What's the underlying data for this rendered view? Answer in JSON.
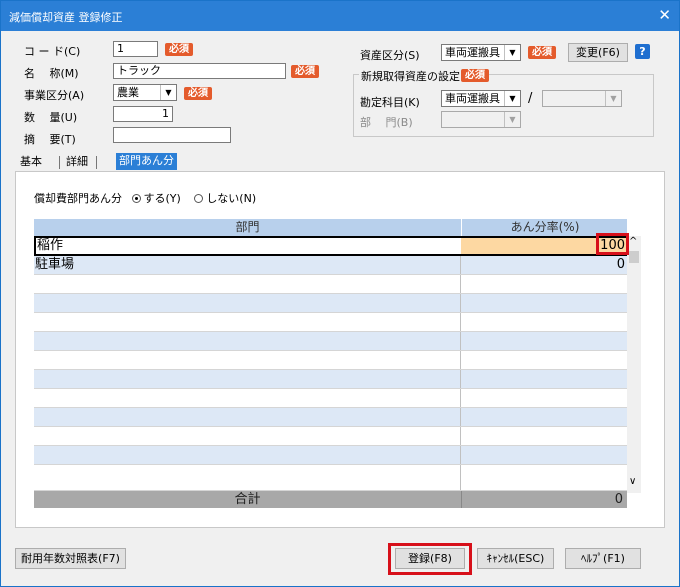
{
  "window": {
    "title": "減価償却資産 登録修正"
  },
  "required_label": "必須",
  "fields": {
    "code": {
      "label": "コ ー ド(C)",
      "value": "1"
    },
    "name": {
      "label": "名　 称(M)",
      "value": "トラック"
    },
    "business": {
      "label": "事業区分(A)",
      "value": "農業"
    },
    "quantity": {
      "label": "数　 量(U)",
      "value": "1"
    },
    "summary": {
      "label": "摘　 要(T)",
      "value": ""
    },
    "asset_class": {
      "label": "資産区分(S)",
      "value": "車両運搬具"
    },
    "change_button": "変更(F6)",
    "help_icon": "?",
    "new_asset_group": "新規取得資産の設定",
    "account": {
      "label": "勘定科目(K)",
      "value": "車両運搬具",
      "sub_value": ""
    },
    "department": {
      "label": "部　 門(B)",
      "value": ""
    }
  },
  "tabs": [
    "基本",
    "詳細",
    "部門あん分"
  ],
  "allocation": {
    "label": "償却費部門あん分",
    "option_yes": "する(Y)",
    "option_no": "しない(N)"
  },
  "grid": {
    "col_department": "部門",
    "col_ratio": "あん分率(%)",
    "rows": [
      {
        "dept": "稲作",
        "ratio": "100"
      },
      {
        "dept": "駐車場",
        "ratio": "0"
      }
    ],
    "total_label": "合計",
    "total_value": "0"
  },
  "buttons": {
    "table": "耐用年数対照表(F7)",
    "register": "登録(F8)",
    "cancel": "ｷｬﾝｾﾙ(ESC)",
    "help": "ﾍﾙﾌﾟ(F1)"
  },
  "colors": {
    "titlebar": "#2b7fd6",
    "required_badge": "#e45b2c",
    "highlight": "#d7101a",
    "row_alt": "#dde8f6",
    "ratio_selected": "#fdd8a2"
  }
}
